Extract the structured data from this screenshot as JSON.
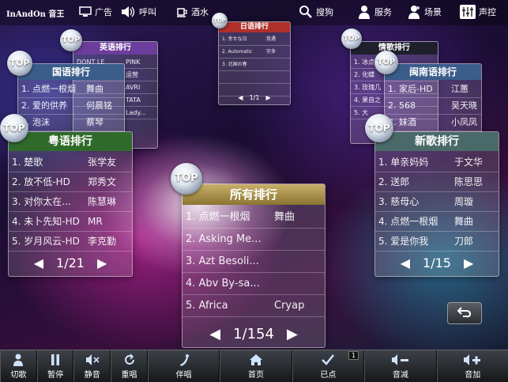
{
  "app": {
    "logo": "InAndOn 音王"
  },
  "topbar": {
    "items": [
      {
        "label": "广告",
        "icon": "tv-icon"
      },
      {
        "label": "呼叫",
        "icon": "speaker-call-icon"
      },
      {
        "label": "酒水",
        "icon": "cup-icon"
      },
      {
        "label": "搜狗",
        "icon": "search-icon"
      },
      {
        "label": "服务",
        "icon": "person-icon"
      },
      {
        "label": "场景",
        "icon": "scene-icon"
      },
      {
        "label": "声控",
        "icon": "mixer-icon"
      }
    ]
  },
  "cards": {
    "english": {
      "top": "TOP",
      "title": "英语排行",
      "rows": [
        {
          "song": "DONT LE",
          "artist": "PINK"
        },
        {
          "song": "",
          "artist": "运营"
        },
        {
          "song": "",
          "artist": "AVRI"
        },
        {
          "song": "",
          "artist": "TATA"
        },
        {
          "song": "",
          "artist": "Lady..."
        }
      ]
    },
    "japanese": {
      "top": "TOP",
      "title": "日语排行",
      "rows": [
        {
          "song": "1. 幸せな日",
          "artist": "我遇"
        },
        {
          "song": "2. Automatic",
          "artist": "宇多"
        },
        {
          "song": "3. 北国の春",
          "artist": ""
        },
        {
          "song": "",
          "artist": ""
        },
        {
          "song": "",
          "artist": ""
        }
      ],
      "page": "1/1"
    },
    "love": {
      "top": "TOP",
      "title": "情歌排行",
      "rows": [
        {
          "song": "1. 冰点",
          "artist": ""
        },
        {
          "song": "2. 化蝶",
          "artist": ""
        },
        {
          "song": "3. 玫瑰几",
          "artist": ""
        },
        {
          "song": "4. 果自之",
          "artist": ""
        },
        {
          "song": "5. 大",
          "artist": ""
        }
      ]
    },
    "mandarin": {
      "top": "TOP",
      "title": "国语排行",
      "rows": [
        {
          "song": "1. 点燃一根烟",
          "artist": "舞曲"
        },
        {
          "song": "2. 爱的供养",
          "artist": "何晨铭"
        },
        {
          "song": "3. 泡沫",
          "artist": "蔡琴"
        }
      ]
    },
    "minnan": {
      "top": "TOP",
      "title": "闽南语排行",
      "rows": [
        {
          "song": "1. 家后-HD",
          "artist": "江蕙"
        },
        {
          "song": "2. 568",
          "artist": "吴天晓"
        },
        {
          "song": "3. 妹酒",
          "artist": "小凤凤"
        }
      ]
    },
    "cantonese": {
      "top": "TOP",
      "title": "粤语排行",
      "rows": [
        {
          "song": "1. 楚歌",
          "artist": "张学友"
        },
        {
          "song": "2. 放不低-HD",
          "artist": "郑秀文"
        },
        {
          "song": "3. 对你太在...",
          "artist": "陈慧琳"
        },
        {
          "song": "4. 未卜先知-HD",
          "artist": "MR"
        },
        {
          "song": "5. 岁月风云-HD",
          "artist": "李克勤"
        }
      ],
      "page": "1/21"
    },
    "newsong": {
      "top": "TOP",
      "title": "新歌排行",
      "rows": [
        {
          "song": "1. 单亲妈妈",
          "artist": "于文华"
        },
        {
          "song": "2. 送郎",
          "artist": "陈思思"
        },
        {
          "song": "3. 慈母心",
          "artist": "周璇"
        },
        {
          "song": "4. 点燃一根烟",
          "artist": "舞曲"
        },
        {
          "song": "5. 爱是你我",
          "artist": "刀郎"
        }
      ],
      "page": "1/15"
    },
    "all": {
      "top": "TOP",
      "title": "所有排行",
      "rows": [
        {
          "song": "1. 点燃一根烟",
          "artist": "舞曲"
        },
        {
          "song": "2. Asking Me...",
          "artist": ""
        },
        {
          "song": "3. Azt Besoli...",
          "artist": ""
        },
        {
          "song": "4. Abv By-sa...",
          "artist": ""
        },
        {
          "song": "5. Africa",
          "artist": "Cryap"
        }
      ],
      "page": "1/154"
    }
  },
  "bottombar": {
    "buttons": [
      {
        "label": "切歌",
        "icon": "skip-person-icon"
      },
      {
        "label": "暂停",
        "icon": "pause-icon"
      },
      {
        "label": "静音",
        "icon": "mute-icon"
      },
      {
        "label": "重唱",
        "icon": "replay-icon"
      },
      {
        "label": "伴唱",
        "icon": "accompany-icon"
      },
      {
        "label": "首页",
        "icon": "home-icon"
      },
      {
        "label": "已点",
        "icon": "check-icon",
        "badge": "1"
      },
      {
        "label": "音减",
        "icon": "volume-down-icon"
      },
      {
        "label": "音加",
        "icon": "volume-up-icon"
      }
    ]
  },
  "colors": {
    "green_header": "#2f6a2a",
    "gold_header": "#a38a3a",
    "blue_header": "#3a5d8a",
    "purple_header": "#6c3d9c",
    "red_header": "#b0302a"
  }
}
